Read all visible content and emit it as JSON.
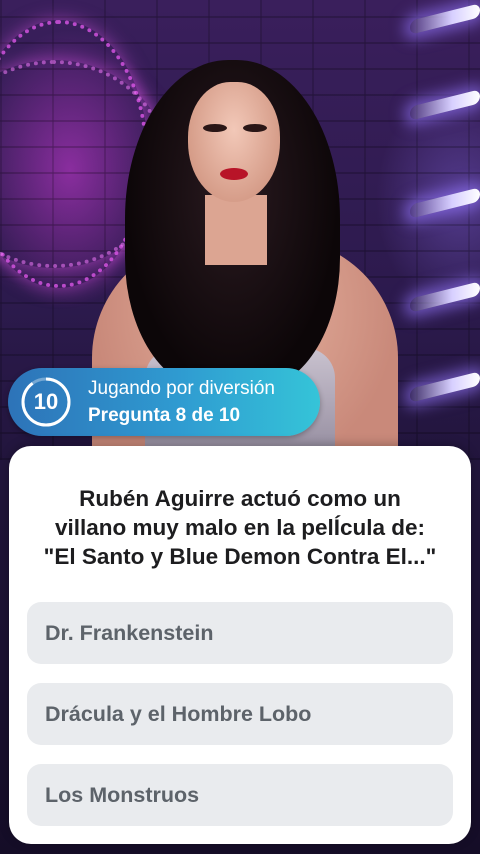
{
  "status": {
    "timer_value": "10",
    "mode": "Jugando por diversión",
    "progress": "Pregunta 8 de 10"
  },
  "question": {
    "line1": "Rubén Aguirre actuó como un",
    "line2": "villano muy malo en la pelÍcula de:",
    "line3": "\"El Santo y Blue Demon Contra El...\""
  },
  "answers": [
    {
      "label": "Dr. Frankenstein"
    },
    {
      "label": "Drácula y el Hombre Lobo"
    },
    {
      "label": "Los Monstruos"
    }
  ],
  "colors": {
    "pill_start": "#2d73b8",
    "pill_end": "#35c4d8",
    "answer_bg": "#e9ebee",
    "answer_text": "#5d636a",
    "question_text": "#1d1d1f"
  }
}
